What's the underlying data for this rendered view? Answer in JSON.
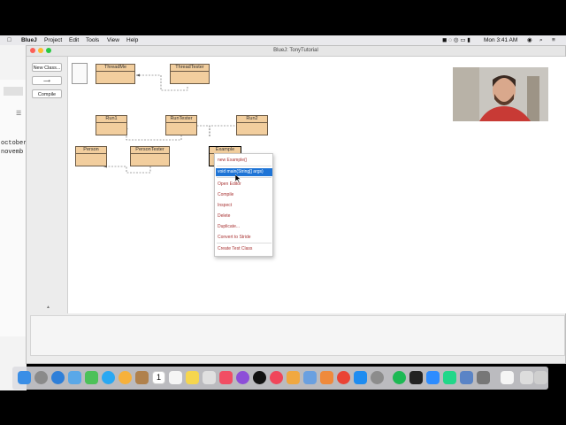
{
  "menubar": {
    "items": [
      "BlueJ",
      "Project",
      "Edit",
      "Tools",
      "View",
      "Help"
    ],
    "clock": "Mon 3:41 AM"
  },
  "window": {
    "title": "BlueJ:  TonyTutorial"
  },
  "toolbar": {
    "new_class": "New Class...",
    "compile": "Compile"
  },
  "background_window": {
    "lines": [
      "october",
      "novemb"
    ]
  },
  "classes": [
    {
      "name": "ThreadMe"
    },
    {
      "name": "ThreadTester"
    },
    {
      "name": "Run1"
    },
    {
      "name": "RunTester"
    },
    {
      "name": "Run2"
    },
    {
      "name": "Person"
    },
    {
      "name": "PersonTester"
    },
    {
      "name": "Example"
    }
  ],
  "context_menu": {
    "items": [
      {
        "label": "new Example()"
      },
      {
        "label": "void main(String[] args)"
      },
      {
        "label": "Open Editor"
      },
      {
        "label": "Compile"
      },
      {
        "label": "Inspect"
      },
      {
        "label": "Delete"
      },
      {
        "label": "Duplicate..."
      },
      {
        "label": "Convert to Stride"
      },
      {
        "label": "Create Test Class"
      }
    ]
  },
  "dock": {
    "calendar_day": "1"
  },
  "colors": {
    "class_fill": "#f2ce9e",
    "highlight": "#1e74d6",
    "menu_text": "#a83232"
  }
}
